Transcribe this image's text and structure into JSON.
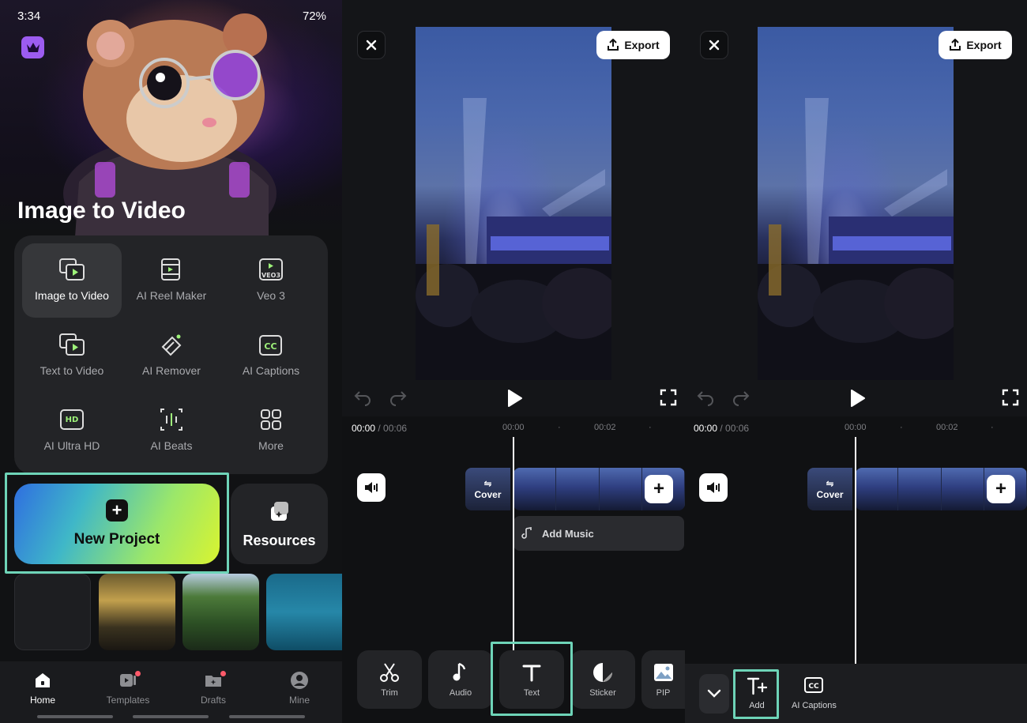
{
  "status": {
    "time": "3:34",
    "battery": "72%"
  },
  "home": {
    "hero_title": "Image to Video",
    "tools": [
      {
        "label": "Image to Video",
        "icon": "image-to-video-icon"
      },
      {
        "label": "AI Reel Maker",
        "icon": "reel-maker-icon"
      },
      {
        "label": "Veo 3",
        "icon": "veo3-icon"
      },
      {
        "label": "Text to Video",
        "icon": "text-to-video-icon"
      },
      {
        "label": "AI Remover",
        "icon": "eraser-icon"
      },
      {
        "label": "AI Captions",
        "icon": "captions-icon"
      },
      {
        "label": "AI Ultra HD",
        "icon": "hd-icon"
      },
      {
        "label": "AI Beats",
        "icon": "beats-icon"
      },
      {
        "label": "More",
        "icon": "grid-icon"
      }
    ],
    "new_project": "New Project",
    "resources": "Resources",
    "nav": [
      {
        "label": "Home"
      },
      {
        "label": "Templates"
      },
      {
        "label": "Drafts"
      },
      {
        "label": "Mine"
      }
    ]
  },
  "editor": {
    "export": "Export",
    "timecode_current": "00:00",
    "timecode_total": " / 00:06",
    "tick_0": "00:00",
    "tick_2": "00:02",
    "cover": "Cover",
    "add_music": "Add Music",
    "toolbar": [
      {
        "label": "Trim"
      },
      {
        "label": "Audio"
      },
      {
        "label": "Text"
      },
      {
        "label": "Sticker"
      },
      {
        "label": "PIP"
      }
    ],
    "text_tools": [
      {
        "label": "Add"
      },
      {
        "label": "AI Captions"
      }
    ]
  },
  "colors": {
    "highlight": "#6ed4b8",
    "accent_purple": "#9c5cf0"
  }
}
